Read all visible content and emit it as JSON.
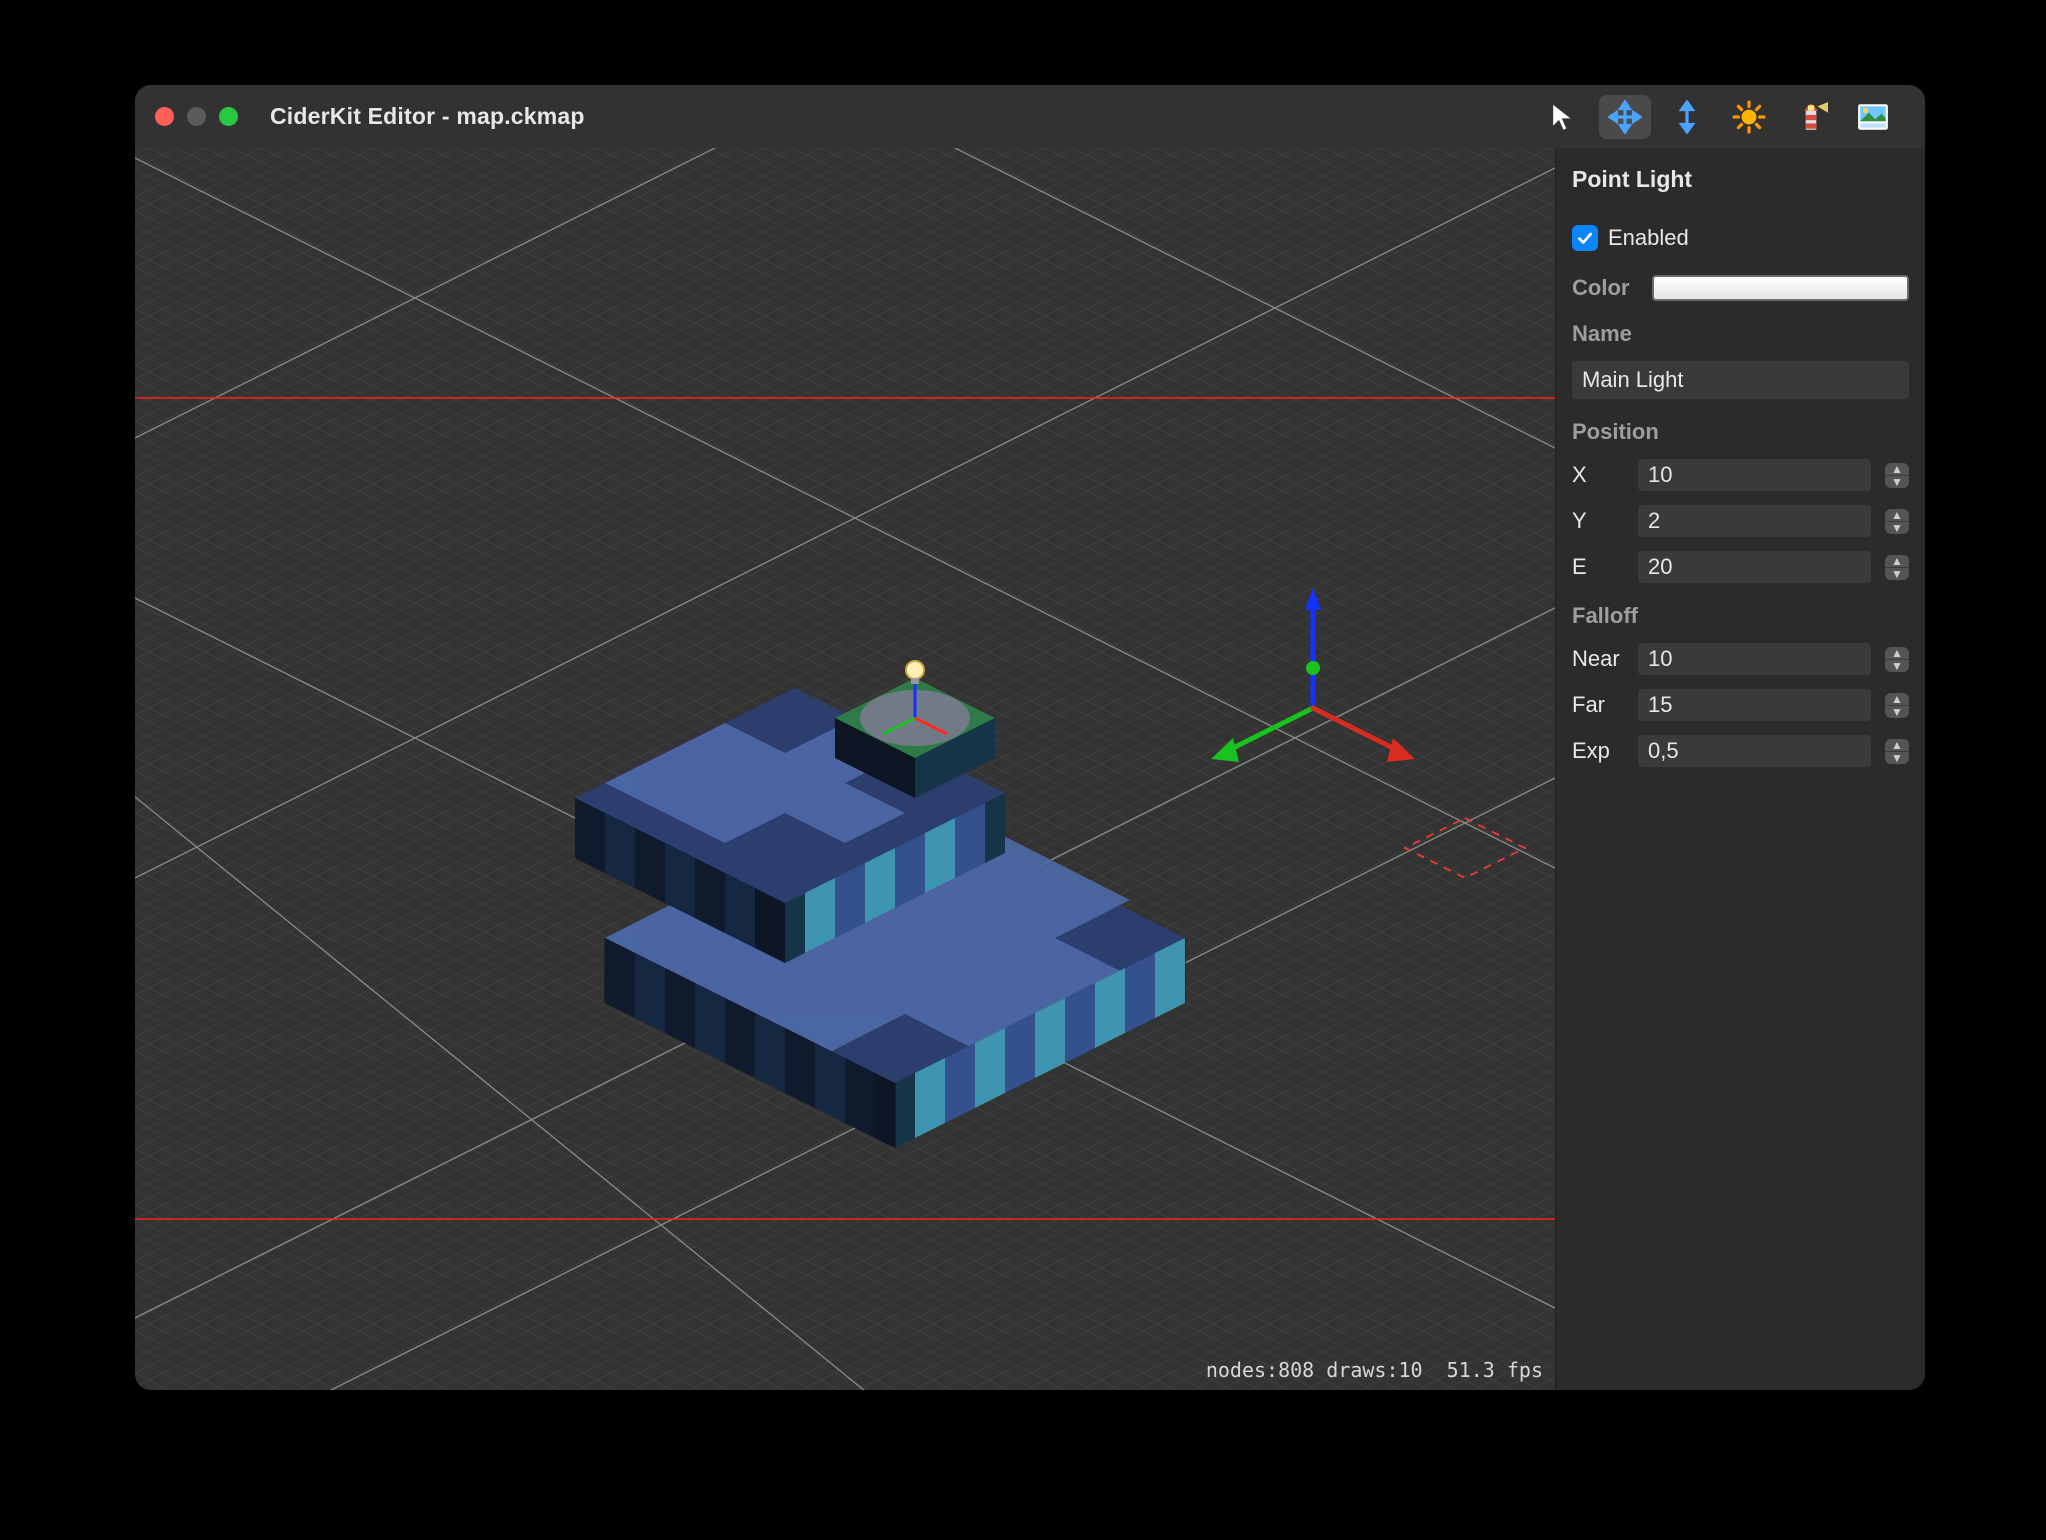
{
  "window": {
    "title": "CiderKit Editor - map.ckmap"
  },
  "toolbar": {
    "items": [
      {
        "name": "select-tool",
        "icon": "cursor",
        "active": false
      },
      {
        "name": "move-tool",
        "icon": "move",
        "active": true
      },
      {
        "name": "elevate-tool",
        "icon": "elevate",
        "active": false
      },
      {
        "name": "sun-tool",
        "icon": "sun",
        "active": false
      },
      {
        "name": "lighthouse-tool",
        "icon": "lighthouse",
        "active": false
      },
      {
        "name": "scene-tool",
        "icon": "scene",
        "active": false
      }
    ]
  },
  "stats": {
    "nodes": 808,
    "draws": 10,
    "fps": "51.3",
    "text": "nodes:808 draws:10  51.3 fps"
  },
  "inspector": {
    "title": "Point Light",
    "enabled_label": "Enabled",
    "enabled": true,
    "color_label": "Color",
    "color": "#ffffff",
    "name_label": "Name",
    "name_value": "Main Light",
    "position_label": "Position",
    "position": {
      "x_label": "X",
      "x": "10",
      "y_label": "Y",
      "y": "2",
      "e_label": "E",
      "e": "20"
    },
    "falloff_label": "Falloff",
    "falloff": {
      "near_label": "Near",
      "near": "10",
      "far_label": "Far",
      "far": "15",
      "exp_label": "Exp",
      "exp": "0,5"
    }
  }
}
